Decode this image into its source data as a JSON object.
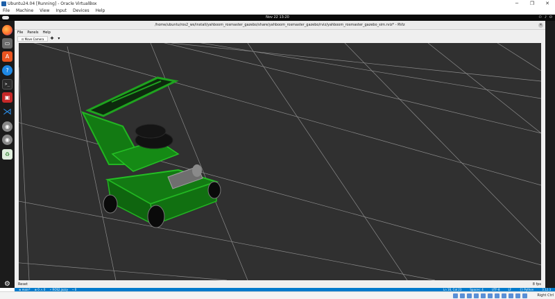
{
  "vbox": {
    "title": "Ubuntu24.04 [Running] - Oracle VirtualBox",
    "controls": {
      "minimize": "─",
      "restore": "❐",
      "close": "✕"
    },
    "menu": [
      "File",
      "Machine",
      "View",
      "Input",
      "Devices",
      "Help"
    ],
    "host_key": "Right Ctrl"
  },
  "gnome": {
    "clock": "Nov 22  13:20",
    "tray": [
      "⚇",
      "♪",
      "⏻"
    ]
  },
  "dock": {
    "items": [
      {
        "name": "firefox",
        "glyph": ""
      },
      {
        "name": "files",
        "glyph": "▭"
      },
      {
        "name": "app-center",
        "glyph": "A"
      },
      {
        "name": "help",
        "glyph": "?"
      },
      {
        "name": "terminal",
        "glyph": ">_"
      },
      {
        "name": "screenshot",
        "glyph": "▣"
      },
      {
        "name": "vscode",
        "glyph": "⋊"
      },
      {
        "name": "disc-1",
        "glyph": "◉"
      },
      {
        "name": "disc-2",
        "glyph": "◉"
      },
      {
        "name": "trash",
        "glyph": "♻"
      },
      {
        "name": "show-apps",
        "glyph": "⚙"
      }
    ]
  },
  "rviz": {
    "title": "/home/ubuntu/ros2_ws/install/yahboom_rosmaster_gazebo/share/yahboom_rosmaster_gazebo/rviz/yahboom_rosmaster_gazebo_sim.rviz* - RViz",
    "close": "✕",
    "menu": [
      "File",
      "Panels",
      "Help"
    ],
    "tabs": [
      "⊡ Move Camera"
    ],
    "tab_add": "✚",
    "tab_more": "▾",
    "reset": "Reset",
    "fps": "8 fps"
  },
  "code_status": {
    "left": [
      "⊗ main*",
      "⊗ 0 ⚠ 0",
      "⚡ ROS2.jazzy",
      "⌁ 0"
    ],
    "right": [
      "Ln 16, Col 23",
      "Spaces: 4",
      "UTF-8",
      "LF",
      "{} Python",
      "3.12.3"
    ]
  },
  "colors": {
    "viewport_bg": "#303030",
    "grid": "#9a9a9a",
    "robot_green": "#1fa31f",
    "vscode_blue": "#007acc"
  }
}
